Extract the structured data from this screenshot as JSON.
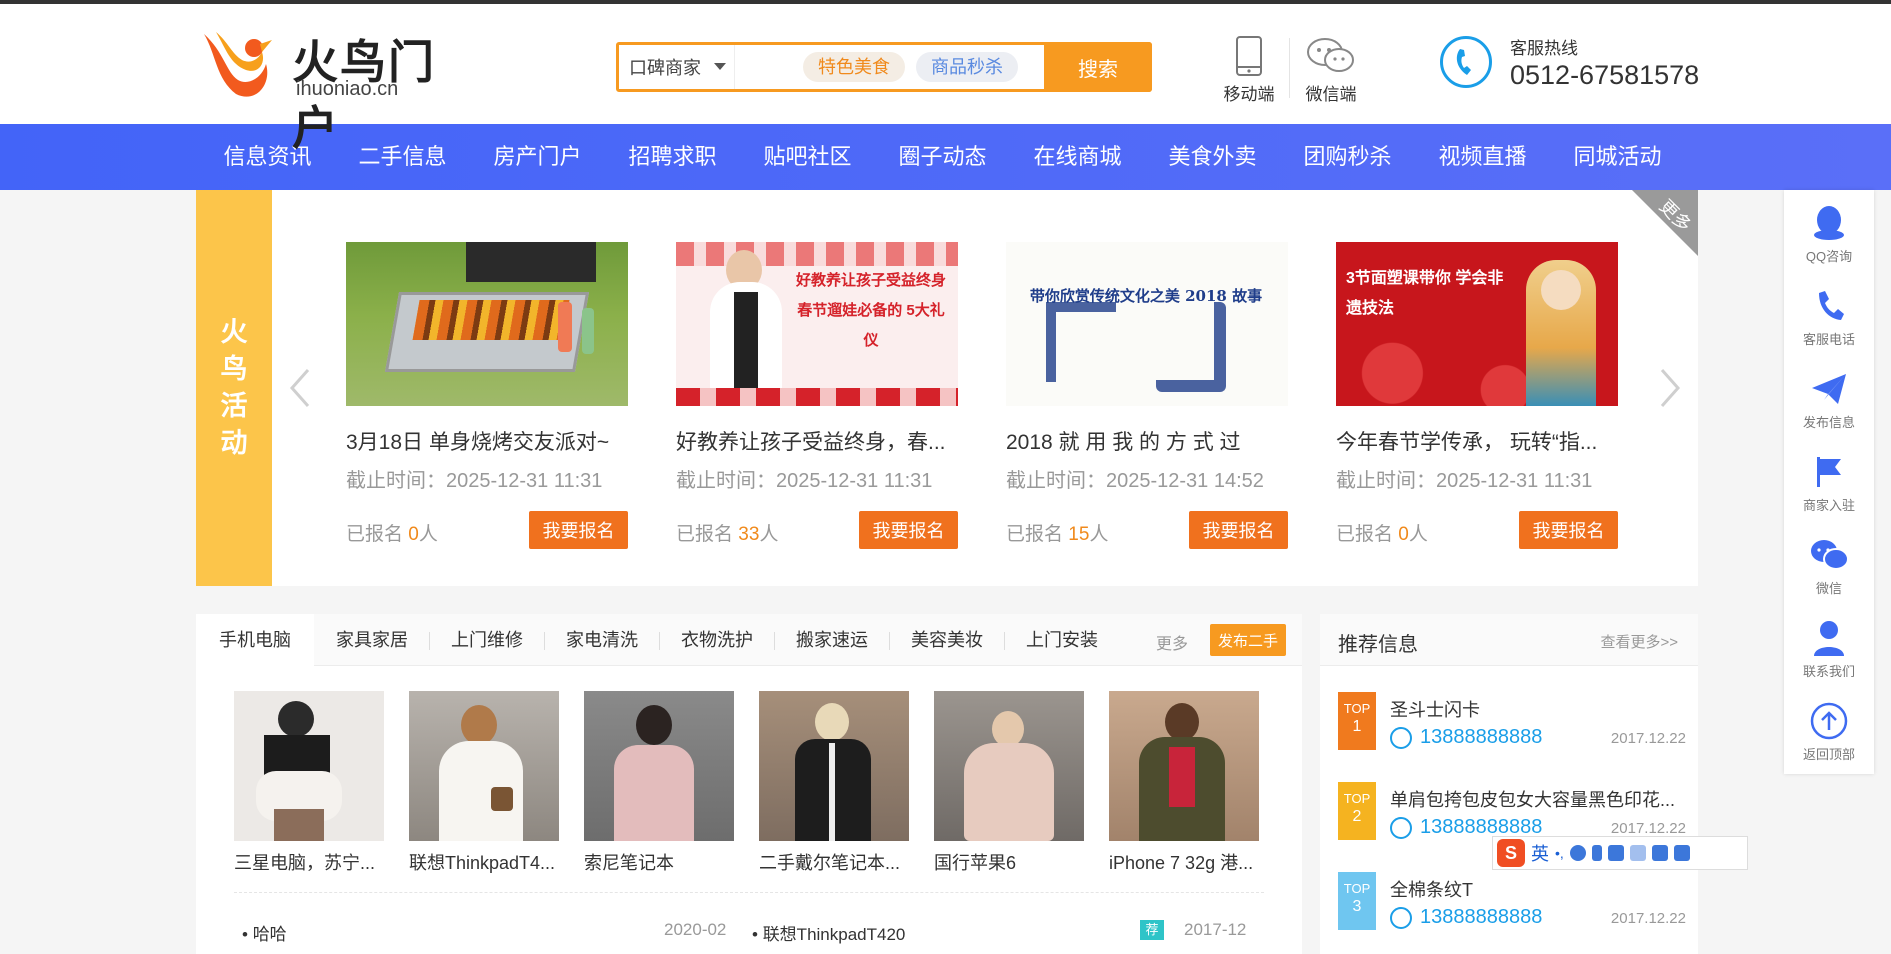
{
  "header": {
    "logo_name": "火鸟门户",
    "logo_url": "ihuoniao.cn",
    "search_type": "口碑商家",
    "search_tags": [
      "特色美食",
      "商品秒杀"
    ],
    "search_button": "搜索",
    "mobile_label": "移动端",
    "wechat_label": "微信端",
    "hotline_label": "客服热线",
    "hotline_number": "0512-67581578"
  },
  "nav": [
    "信息资讯",
    "二手信息",
    "房产门户",
    "招聘求职",
    "贴吧社区",
    "圈子动态",
    "在线商城",
    "美食外卖",
    "团购秒杀",
    "视频直播",
    "同城活动"
  ],
  "activity": {
    "side_title": "火鸟活动",
    "more_label": "更多",
    "signup_prefix": "已报名",
    "signup_suffix": "人",
    "button_label": "我要报名",
    "cards": [
      {
        "title": "3月18日 单身烧烤交友派对~",
        "deadline": "截止时间：2025-12-31 11:31",
        "count": "0",
        "img_text": ""
      },
      {
        "title": "好教养让孩子受益终身，春...",
        "deadline": "截止时间：2025-12-31 11:31",
        "count": "33",
        "img_text": "好教养让孩子受益终身 春节遛娃必备的 5大礼仪"
      },
      {
        "title": "2018 就 用 我 的 方 式 过",
        "deadline": "截止时间：2025-12-31 14:52",
        "count": "15",
        "img_text": "带你欣赏传统文化之美 2018 故事"
      },
      {
        "title": "今年春节学传承， 玩转“指...",
        "deadline": "截止时间：2025-12-31 11:31",
        "count": "0",
        "img_text": "3节面塑课带你 学会非遗技法"
      }
    ]
  },
  "ads": {
    "tabs": [
      "手机电脑",
      "家具家居",
      "上门维修",
      "家电清洗",
      "衣物洗护",
      "搬家速运",
      "美容美妆",
      "上门安装"
    ],
    "more_label": "更多",
    "post_label": "发布二手",
    "products": [
      "三星电脑，苏宁...",
      "联想ThinkpadT4...",
      "索尼笔记本",
      "二手戴尔笔记本...",
      "国行苹果6",
      "iPhone 7 32g 港..."
    ],
    "list": [
      {
        "title": "哈哈",
        "date": "2020-02"
      },
      {
        "title": "联想ThinkpadT420",
        "date": "2017-12"
      }
    ],
    "list_badge": "荐"
  },
  "recommend": {
    "title": "推荐信息",
    "more_label": "查看更多>>",
    "items": [
      {
        "rank_label": "TOP",
        "rank": "1",
        "name": "圣斗士闪卡",
        "phone": "13888888888",
        "date": "2017.12.22",
        "color": "#f07a1e"
      },
      {
        "rank_label": "TOP",
        "rank": "2",
        "name": "单肩包挎包皮包女大容量黑色印花...",
        "phone": "13888888888",
        "date": "2017.12.22",
        "color": "#f5b320"
      },
      {
        "rank_label": "TOP",
        "rank": "3",
        "name": "全棉条纹T",
        "phone": "13888888888",
        "date": "2017.12.22",
        "color": "#6fc6f0"
      }
    ]
  },
  "toolbar": [
    "QQ咨询",
    "客服电话",
    "发布信息",
    "商家入驻",
    "微信",
    "联系我们",
    "返回顶部"
  ],
  "ime": {
    "lang": "英"
  },
  "colors": {
    "accent": "#f79a20",
    "nav": "#4364f8",
    "phone": "#1a9ee8"
  }
}
